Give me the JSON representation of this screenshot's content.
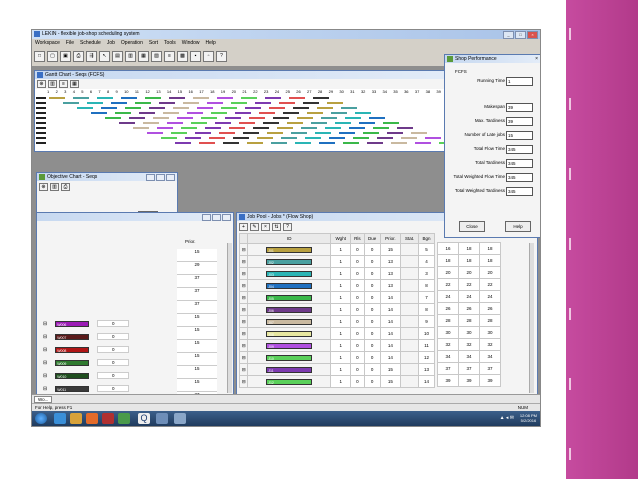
{
  "app": {
    "title": "LEKIN - flexible job-shop scheduling system",
    "menu": [
      "Workspace",
      "File",
      "Schedule",
      "Job",
      "Operation",
      "Sort",
      "Tools",
      "Window",
      "Help"
    ],
    "toolbar_icons": [
      "new-icon",
      "open-icon",
      "save-icon",
      "print-icon",
      "sequence-icon",
      "cursor-icon",
      "gantt-icon",
      "chart-icon",
      "grid-icon",
      "table-icon",
      "list-icon",
      "machine-icon",
      "job-icon",
      "tile-icon",
      "help-icon"
    ]
  },
  "gantt": {
    "title": "Gantt Chart - Seqs (FCFS)",
    "ticks": [
      "1",
      "2",
      "3",
      "4",
      "5",
      "6",
      "7",
      "8",
      "9",
      "10",
      "11",
      "12",
      "13",
      "14",
      "15",
      "16",
      "17",
      "18",
      "19",
      "20",
      "21",
      "22",
      "23",
      "24",
      "25",
      "26",
      "27",
      "28",
      "29",
      "30",
      "31",
      "32",
      "33",
      "34",
      "35",
      "36",
      "37",
      "38",
      "39",
      "40"
    ]
  },
  "objective": {
    "title": "Objective Chart - Seqs",
    "legend": "FCFS",
    "axes": [
      "Cmax",
      "Lmax",
      "ΣUj",
      "ΣCj",
      "ΣTj",
      "ΣwCj",
      "ΣwTj",
      "ΣwUj"
    ]
  },
  "left_table": {
    "header": "Prior.",
    "prior": [
      "15",
      "29",
      "37",
      "37",
      "37",
      "15",
      "15",
      "15",
      "15",
      "15",
      "15",
      "37",
      "15",
      "15"
    ],
    "rows": [
      {
        "id": "W006",
        "color": "#9b1bb5",
        "val": "0"
      },
      {
        "id": "W007",
        "color": "#5a1a1a",
        "val": "0"
      },
      {
        "id": "W008",
        "color": "#b01616",
        "val": "0"
      },
      {
        "id": "W009",
        "color": "#2f7a2f",
        "val": "0"
      },
      {
        "id": "W010",
        "color": "#1e4d1e",
        "val": "0"
      },
      {
        "id": "W011",
        "color": "#3a3a3a",
        "val": "0"
      },
      {
        "id": "W012",
        "color": "#2c3e66",
        "val": "0"
      }
    ]
  },
  "job_pool": {
    "title": "Job Pool - Jobs * (Flow Shop)",
    "headers": [
      "ID",
      "Wght",
      "Rls",
      "Due",
      "Prior.",
      "Stat.",
      "Bgn"
    ],
    "rows": [
      {
        "id": "J01",
        "color": "#b8a040",
        "wght": "1",
        "rls": "0",
        "due": "0",
        "prior": "15",
        "bgn": "5"
      },
      {
        "id": "J02",
        "color": "#4aa0a0",
        "wght": "1",
        "rls": "0",
        "due": "0",
        "prior": "13",
        "bgn": "4"
      },
      {
        "id": "J03",
        "color": "#2ab5b5",
        "wght": "1",
        "rls": "0",
        "due": "0",
        "prior": "13",
        "bgn": "3"
      },
      {
        "id": "J04",
        "color": "#1f70c0",
        "wght": "1",
        "rls": "0",
        "due": "0",
        "prior": "13",
        "bgn": "8"
      },
      {
        "id": "J05",
        "color": "#3bb84a",
        "wght": "1",
        "rls": "0",
        "due": "0",
        "prior": "14",
        "bgn": "7"
      },
      {
        "id": "J06",
        "color": "#6e3a8a",
        "wght": "1",
        "rls": "0",
        "due": "0",
        "prior": "14",
        "bgn": "8"
      },
      {
        "id": "J07",
        "color": "#c9b9a0",
        "wght": "1",
        "rls": "0",
        "due": "0",
        "prior": "14",
        "bgn": "9"
      },
      {
        "id": "J08",
        "color": "#e8e8a0",
        "wght": "1",
        "rls": "0",
        "due": "0",
        "prior": "14",
        "bgn": "10"
      },
      {
        "id": "J09",
        "color": "#b050e0",
        "wght": "1",
        "rls": "0",
        "due": "0",
        "prior": "14",
        "bgn": "11"
      },
      {
        "id": "J10",
        "color": "#5ad05a",
        "wght": "1",
        "rls": "0",
        "due": "0",
        "prior": "14",
        "bgn": "12"
      },
      {
        "id": "J11",
        "color": "#7d3ab0",
        "wght": "1",
        "rls": "0",
        "due": "0",
        "prior": "15",
        "bgn": "13"
      },
      {
        "id": "J12",
        "color": "#5ad05a",
        "wght": "1",
        "rls": "0",
        "due": "0",
        "prior": "15",
        "bgn": "14"
      }
    ],
    "extra_cols": [
      [
        "16",
        "18",
        "18"
      ],
      [
        "18",
        "18",
        "18"
      ],
      [
        "20",
        "20",
        "20"
      ],
      [
        "22",
        "22",
        "22"
      ],
      [
        "24",
        "24",
        "24"
      ],
      [
        "26",
        "26",
        "26"
      ],
      [
        "28",
        "28",
        "28"
      ],
      [
        "30",
        "30",
        "30"
      ],
      [
        "32",
        "32",
        "32"
      ],
      [
        "34",
        "34",
        "34"
      ],
      [
        "37",
        "37",
        "37"
      ],
      [
        "39",
        "39",
        "39"
      ]
    ]
  },
  "perf": {
    "title": "Shop Performance",
    "section": "FCFS",
    "running_label": "Running Time",
    "running_value": "1",
    "metrics": [
      {
        "label": "Makespan",
        "value": "39"
      },
      {
        "label": "Max. Tardiness",
        "value": "39"
      },
      {
        "label": "Number of Late jobs",
        "value": "15"
      },
      {
        "label": "Total Flow Time",
        "value": "345"
      },
      {
        "label": "Total Tardiness",
        "value": "345"
      },
      {
        "label": "Total Weighted Flow Time",
        "value": "345"
      },
      {
        "label": "Total Weighted Tardiness",
        "value": "345"
      }
    ],
    "close_label": "Close",
    "help_label": "Help"
  },
  "tab_label": "Wo...",
  "status_left": "For Help, press F1",
  "status_right": "NUM",
  "clock_time": "12:08 PM",
  "clock_date": "5/2/2016"
}
